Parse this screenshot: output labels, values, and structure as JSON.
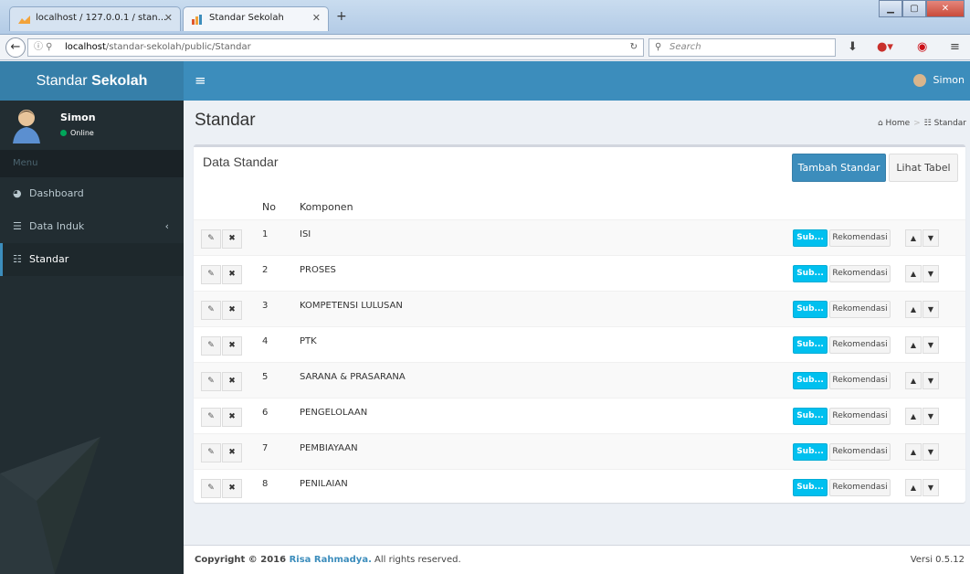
{
  "browser": {
    "tabs": [
      {
        "label": "localhost / 127.0.0.1 / stan..."
      },
      {
        "label": "Standar Sekolah"
      }
    ],
    "url_host": "localhost",
    "url_path": "/standar-sekolah/public/Standar",
    "search_placeholder": "Search"
  },
  "app": {
    "logo_light": "Standar ",
    "logo_bold": "Sekolah",
    "header_user": "Simon",
    "header_color": "#3c8dbc"
  },
  "sidebar": {
    "user_name": "Simon",
    "user_status": "Online",
    "menu_header": "Menu",
    "items": [
      {
        "label": "Dashboard",
        "icon": "dashboard-icon"
      },
      {
        "label": "Data Induk",
        "icon": "database-icon"
      },
      {
        "label": "Standar",
        "icon": "sliders-icon"
      }
    ]
  },
  "page": {
    "title": "Standar",
    "breadcrumb_home": "Home",
    "breadcrumb_current": "Standar"
  },
  "box": {
    "title": "Data Standar",
    "add_button": "Tambah Standar",
    "view_button": "Lihat Tabel",
    "col_no": "No",
    "col_komponen": "Komponen",
    "sub_label": "Sub...",
    "rekomendasi_label": "Rekomendasi",
    "rows": [
      {
        "no": "1",
        "name": "ISI"
      },
      {
        "no": "2",
        "name": "PROSES"
      },
      {
        "no": "3",
        "name": "KOMPETENSI LULUSAN"
      },
      {
        "no": "4",
        "name": "PTK"
      },
      {
        "no": "5",
        "name": "SARANA & PRASARANA"
      },
      {
        "no": "6",
        "name": "PENGELOLAAN"
      },
      {
        "no": "7",
        "name": "PEMBIAYAAN"
      },
      {
        "no": "8",
        "name": "PENILAIAN"
      }
    ]
  },
  "footer": {
    "copyright": "Copyright © 2016 ",
    "author": "Risa Rahmadya.",
    "rights": " All rights reserved.",
    "version": "Versi 0.5.12"
  }
}
